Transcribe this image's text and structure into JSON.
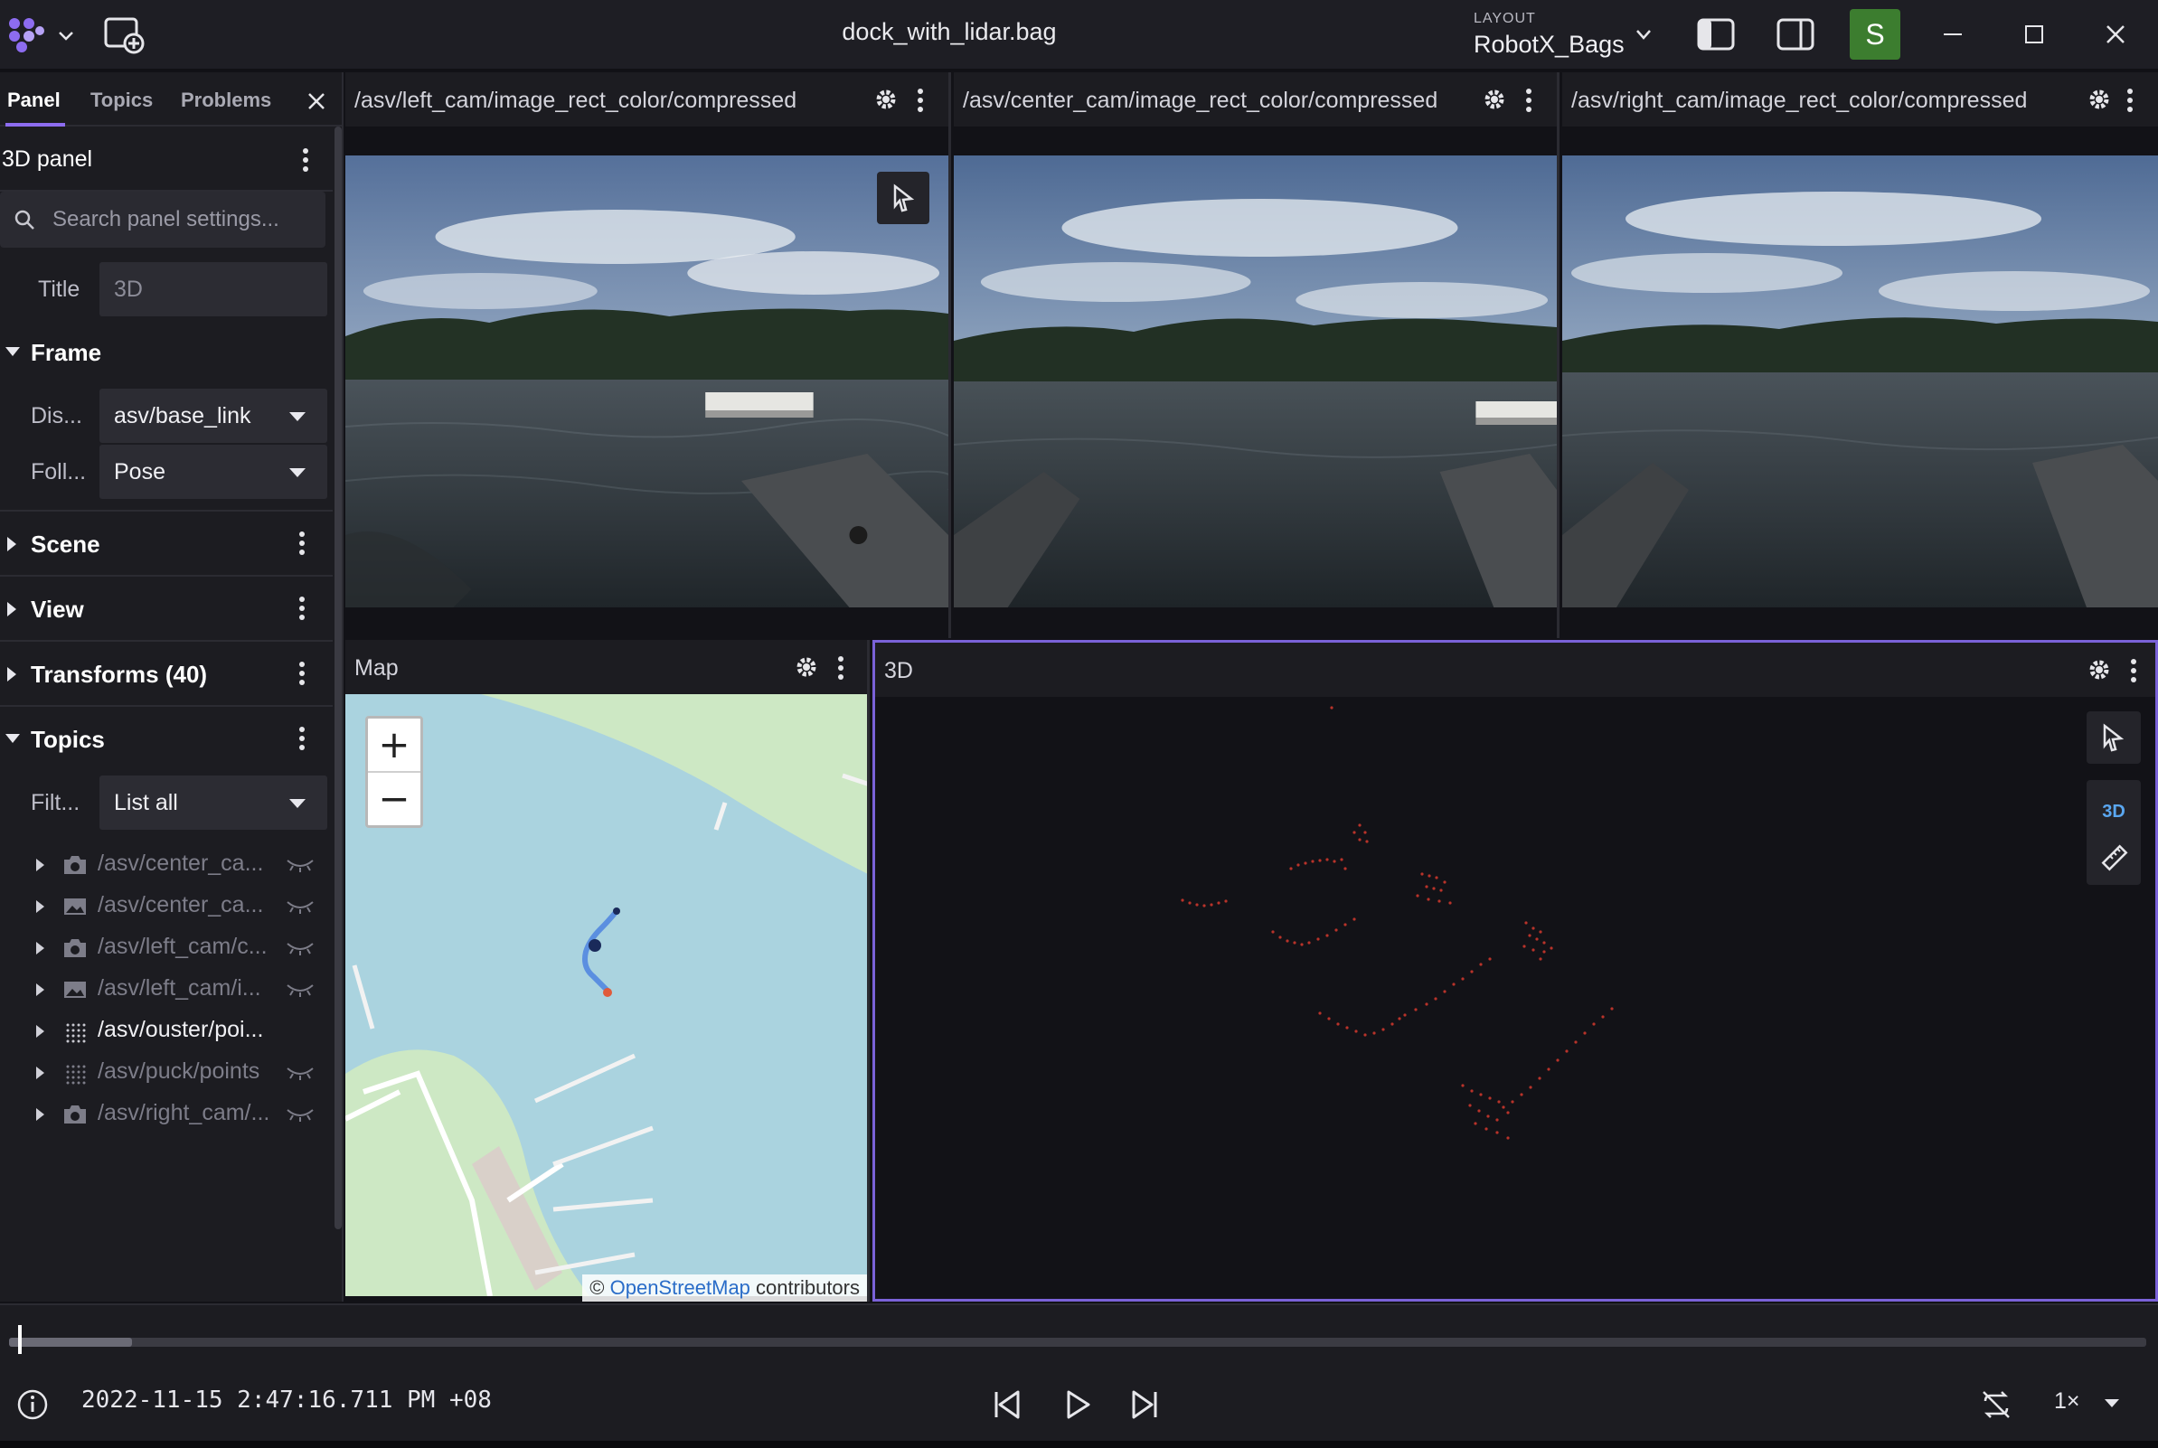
{
  "title_bar": {
    "document_title": "dock_with_lidar.bag",
    "layout_label": "LAYOUT",
    "layout_name": "RobotX_Bags",
    "user_initial": "S",
    "user_color": "#3c7d2f"
  },
  "sidebar": {
    "tabs": [
      {
        "label": "Panel"
      },
      {
        "label": "Topics"
      },
      {
        "label": "Problems"
      }
    ],
    "active_tab": "Panel",
    "panel_name": "3D panel",
    "search_placeholder": "Search panel settings...",
    "title_label": "Title",
    "title_placeholder": "3D",
    "frame": {
      "label": "Frame",
      "display_label": "Dis...",
      "display_value": "asv/base_link",
      "follow_label": "Foll...",
      "follow_value": "Pose"
    },
    "sections": [
      {
        "label": "Scene"
      },
      {
        "label": "View"
      },
      {
        "label": "Transforms (40)"
      }
    ],
    "topics": {
      "label": "Topics",
      "filter_label": "Filt...",
      "filter_value": "List all",
      "items": [
        {
          "name": "/asv/center_ca...",
          "icon": "camera-icon",
          "visible": false
        },
        {
          "name": "/asv/center_ca...",
          "icon": "image-icon",
          "visible": false
        },
        {
          "name": "/asv/left_cam/c...",
          "icon": "camera-icon",
          "visible": false
        },
        {
          "name": "/asv/left_cam/i...",
          "icon": "image-icon",
          "visible": false
        },
        {
          "name": "/asv/ouster/poi...",
          "icon": "pointcloud-icon",
          "visible": true
        },
        {
          "name": "/asv/puck/points",
          "icon": "pointcloud-icon",
          "visible": false
        },
        {
          "name": "/asv/right_cam/...",
          "icon": "camera-icon",
          "visible": false
        }
      ]
    }
  },
  "panels": {
    "left_cam": {
      "title": "/asv/left_cam/image_rect_color/compressed"
    },
    "center_cam": {
      "title": "/asv/center_cam/image_rect_color/compressed"
    },
    "right_cam": {
      "title": "/asv/right_cam/image_rect_color/compressed"
    },
    "map": {
      "title": "Map",
      "zoom_in": "+",
      "zoom_out": "−",
      "attribution_prefix": "©",
      "attribution_link": "OpenStreetMap",
      "attribution_suffix": "contributors"
    },
    "three_d": {
      "title": "3D",
      "mode_label": "3D"
    }
  },
  "playback": {
    "timestamp": "2022-11-15 2:47:16.711 PM +08",
    "speed": "1×",
    "progress": 0.04
  },
  "colors": {
    "accent": "#8d6cf0",
    "selected_panel_border": "#7a62d8",
    "pointcloud": "#c0392b"
  }
}
